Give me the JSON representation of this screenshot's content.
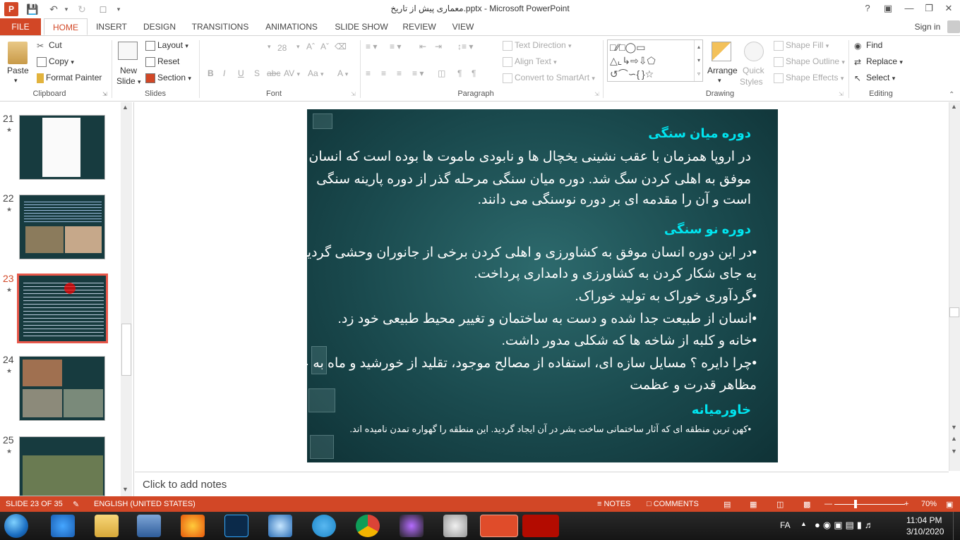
{
  "window": {
    "title": "معماری پیش از تاریخ.pptx - Microsoft PowerPoint",
    "help": "?",
    "sign_in": "Sign in"
  },
  "tabs": [
    "FILE",
    "HOME",
    "INSERT",
    "DESIGN",
    "TRANSITIONS",
    "ANIMATIONS",
    "SLIDE SHOW",
    "REVIEW",
    "VIEW"
  ],
  "ribbon": {
    "clipboard": {
      "paste": "Paste",
      "cut": "Cut",
      "copy": "Copy",
      "format_painter": "Format Painter",
      "label": "Clipboard"
    },
    "slides": {
      "new_slide_1": "New",
      "new_slide_2": "Slide",
      "layout": "Layout",
      "reset": "Reset",
      "section": "Section",
      "label": "Slides"
    },
    "font": {
      "size": "28",
      "label": "Font",
      "bold": "B",
      "italic": "I",
      "underline": "U",
      "shadow": "S",
      "spacing": "AV",
      "case": "Aa",
      "color": "A"
    },
    "paragraph": {
      "text_direction": "Text Direction",
      "align_text": "Align Text",
      "convert_smartart": "Convert to SmartArt",
      "label": "Paragraph"
    },
    "drawing": {
      "arrange": "Arrange",
      "quick_1": "Quick",
      "quick_2": "Styles",
      "shape_fill": "Shape Fill",
      "shape_outline": "Shape Outline",
      "shape_effects": "Shape Effects",
      "label": "Drawing"
    },
    "editing": {
      "find": "Find",
      "replace": "Replace",
      "select": "Select",
      "label": "Editing"
    }
  },
  "thumbnails": [
    {
      "num": "21",
      "selected": false
    },
    {
      "num": "22",
      "selected": false
    },
    {
      "num": "23",
      "selected": true
    },
    {
      "num": "24",
      "selected": false
    },
    {
      "num": "25",
      "selected": false
    }
  ],
  "slide": {
    "heading1": "دوره میان سنگی",
    "p1": [
      "در اروپا همزمان با عقب نشینی یخچال ها و نابودی ماموت ها بوده است که انسان",
      "موفق به اهلی کردن سگ شد. دوره میان سنگی مرحله گذر از دوره پارینه سنگی",
      "است و آن را مقدمه ای بر دوره نوسنگی می دانند."
    ],
    "heading2": "دوره نو سنگی",
    "bullets": [
      "•در این دوره انسان موفق به کشاورزی و اهلی کردن برخی از جانوران وحشی گردید و",
      "به جای شکار کردن به کشاورزی و دامداری پرداخت.",
      "•گردآوری خوراک به تولید خوراک.",
      "•انسان از طبیعت جدا شده و دست به ساختمان و تغییر محیط طبیعی خود زد.",
      "•خانه و کلبه از شاخه ها که شکلی مدور داشت.",
      "•چرا دایره ؟ مسایل سازه ای، استفاده از مصالح موجود، تقلید از خورشید و ماه به عنوان",
      "مظاهر قدرت و عظمت"
    ],
    "heading3": "خاورمیانه",
    "p3": "•کهن ترین منطقه ای که آثار ساختمانی ساخت بشر در آن ایجاد گردید. این منطقه را گهواره تمدن نامیده اند."
  },
  "notes_placeholder": "Click to add notes",
  "status": {
    "slide": "SLIDE 23 OF 35",
    "language": "ENGLISH (UNITED STATES)",
    "notes": "NOTES",
    "comments": "COMMENTS",
    "zoom": "70%"
  },
  "taskbar": {
    "lang": "FA",
    "time": "11:04 PM",
    "date": "3/10/2020"
  },
  "colors": {
    "accent": "#d24726",
    "slide_bg": "#1a4a4e",
    "heading": "#00e5f0"
  }
}
